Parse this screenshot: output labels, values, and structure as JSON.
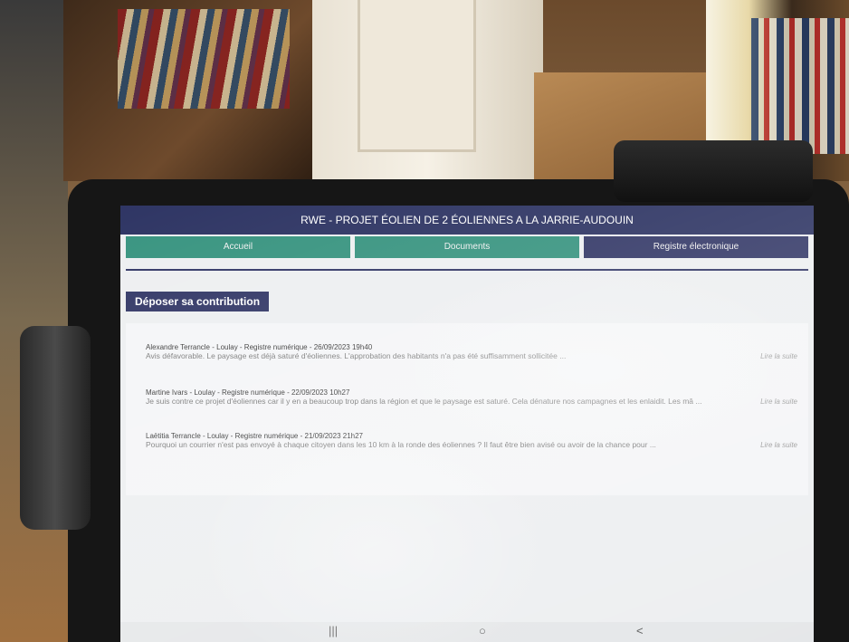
{
  "app": {
    "title": "RWE - PROJET ÉOLIEN DE 2 ÉOLIENNES A LA JARRIE-AUDOUIN"
  },
  "nav": [
    {
      "label": "Accueil"
    },
    {
      "label": "Documents"
    },
    {
      "label": "Registre électronique"
    }
  ],
  "actions": {
    "contribute_label": "Déposer sa contribution"
  },
  "contributions": [
    {
      "header": "Alexandre Terrancle - Loulay - Registre numérique - 26/09/2023 19h40",
      "body": "Avis défavorable. Le paysage est déjà saturé d'éoliennes. L'approbation des habitants n'a pas été suffisamment sollicitée ...",
      "more": "Lire la suite"
    },
    {
      "header": "Martine Ivars - Loulay - Registre numérique - 22/09/2023 10h27",
      "body": "Je suis contre ce projet d'éoliennes car il y en a beaucoup trop dans la région et que le paysage est saturé. Cela dénature nos campagnes et les enlaidit. Les mâ ...",
      "more": "Lire la suite"
    },
    {
      "header": "Laëtitia Terrancle - Loulay - Registre numérique - 21/09/2023 21h27",
      "body": "Pourquoi un courrier n'est pas envoyé à chaque citoyen dans les 10 km à la ronde des éoliennes ? Il faut être bien avisé ou avoir de la chance pour ...",
      "more": "Lire la suite"
    }
  ],
  "system_nav": {
    "recents": "|||",
    "home": "○",
    "back": "<"
  }
}
